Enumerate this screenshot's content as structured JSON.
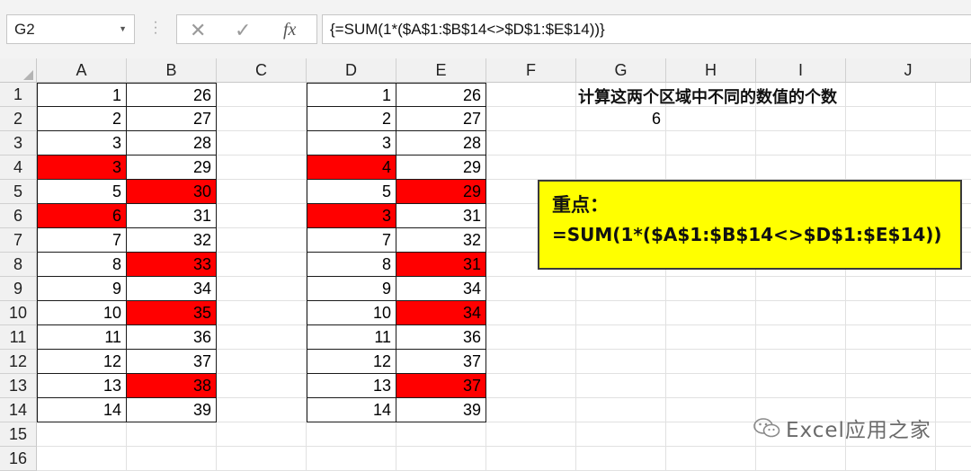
{
  "formula_bar": {
    "name_box": "G2",
    "name_box_dropdown_icon": "chevron-down-icon",
    "cancel_icon": "✕",
    "enter_icon": "✓",
    "fx_icon": "fx",
    "formula": "{=SUM(1*($A$1:$B$14<>$D$1:$E$14))}"
  },
  "columns": [
    "A",
    "B",
    "C",
    "D",
    "E",
    "F",
    "G",
    "H",
    "I",
    "J"
  ],
  "rows": [
    "1",
    "2",
    "3",
    "4",
    "5",
    "6",
    "7",
    "8",
    "9",
    "10",
    "11",
    "12",
    "13",
    "14",
    "15",
    "16"
  ],
  "range1": {
    "a": [
      "1",
      "2",
      "3",
      "3",
      "5",
      "6",
      "7",
      "8",
      "9",
      "10",
      "11",
      "12",
      "13",
      "14"
    ],
    "b": [
      "26",
      "27",
      "28",
      "29",
      "30",
      "31",
      "32",
      "33",
      "34",
      "35",
      "36",
      "37",
      "38",
      "39"
    ]
  },
  "range2": {
    "d": [
      "1",
      "2",
      "3",
      "4",
      "5",
      "3",
      "7",
      "8",
      "9",
      "10",
      "11",
      "12",
      "13",
      "14"
    ],
    "e": [
      "26",
      "27",
      "28",
      "29",
      "29",
      "31",
      "32",
      "31",
      "34",
      "34",
      "36",
      "37",
      "37",
      "39"
    ]
  },
  "highlight_color": "#ff0000",
  "note": "计算这两个区域中不同的数值的个数",
  "result": "6",
  "callout": {
    "title": "重点：",
    "formula": "=SUM(1*($A$1:$B$14<>$D$1:$E$14))",
    "background": "#ffff00"
  },
  "watermark": {
    "text": "Excel应用之家",
    "icon": "wechat-icon"
  }
}
